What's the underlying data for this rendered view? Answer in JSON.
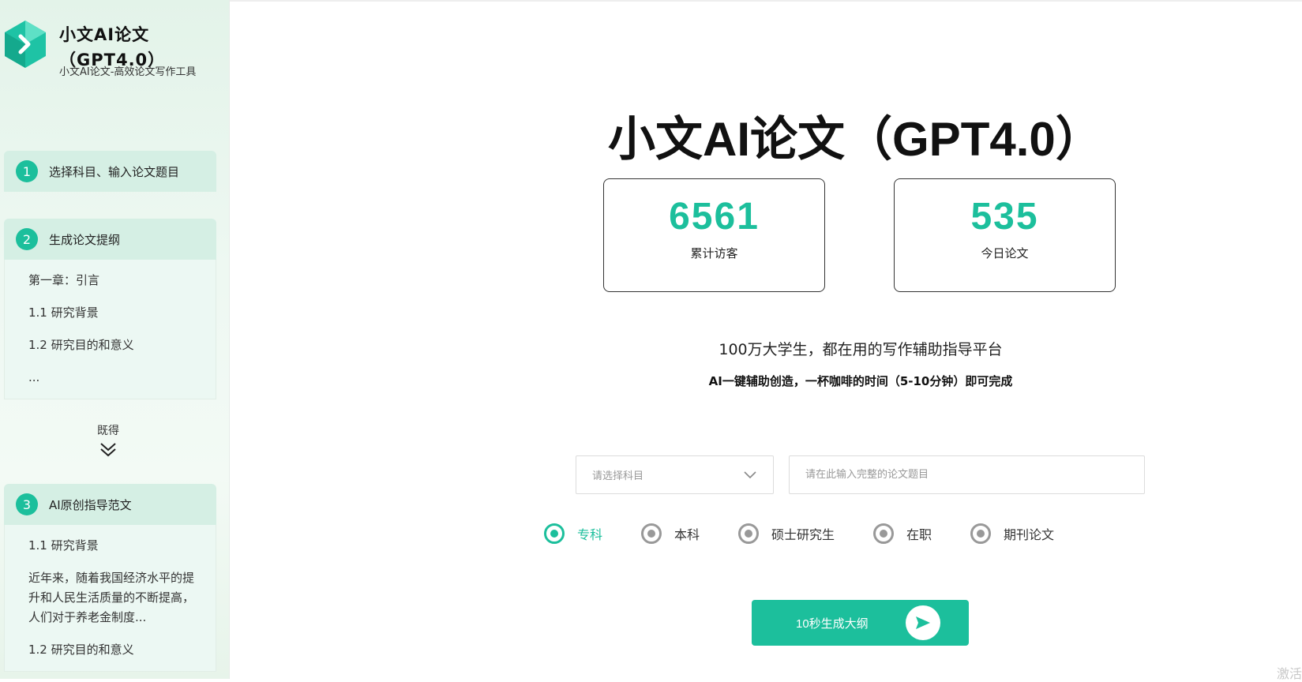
{
  "brand": {
    "title": "小文AI论文（GPT4.0）",
    "subtitle": "小文AI论文-高效论文写作工具"
  },
  "steps": [
    {
      "number": "1",
      "label": "选择科目、输入论文题目"
    },
    {
      "number": "2",
      "label": "生成论文提纲",
      "lines": [
        "第一章：引言",
        "1.1 研究背景",
        "1.2 研究目的和意义",
        "..."
      ]
    },
    {
      "number": "3",
      "label": "AI原创指导范文",
      "lines": [
        "1.1 研究背景"
      ],
      "paragraph": "近年来，随着我国经济水平的提升和人民生活质量的不断提高，人们对于养老金制度...",
      "tail": "1.2 研究目的和意义"
    }
  ],
  "skip_label": "既得",
  "main": {
    "title": "小文AI论文（GPT4.0）",
    "stats": [
      {
        "value": "6561",
        "label": "累计访客"
      },
      {
        "value": "535",
        "label": "今日论文"
      }
    ],
    "tagline": "100万大学生，都在用的写作辅助指导平台",
    "subtagline": "AI一键辅助创造，一杯咖啡的时间（5-10分钟）即可完成"
  },
  "form": {
    "subject_placeholder": "请选择科目",
    "title_placeholder": "请在此输入完整的论文题目",
    "levels": [
      "专科",
      "本科",
      "硕士研究生",
      "在职",
      "期刊论文"
    ],
    "selected_level": "专科"
  },
  "generate_button": "10秒生成大纲",
  "watermark": "激活",
  "colors": {
    "accent": "#1cbf9c",
    "step_bg": "#d5efe4",
    "radio_inactive": "#999999"
  },
  "icons": {
    "logo": "cube-arrow-logo",
    "skip": "double-chevron-down-icon",
    "select": "chevron-down-icon",
    "generate": "send-icon"
  }
}
